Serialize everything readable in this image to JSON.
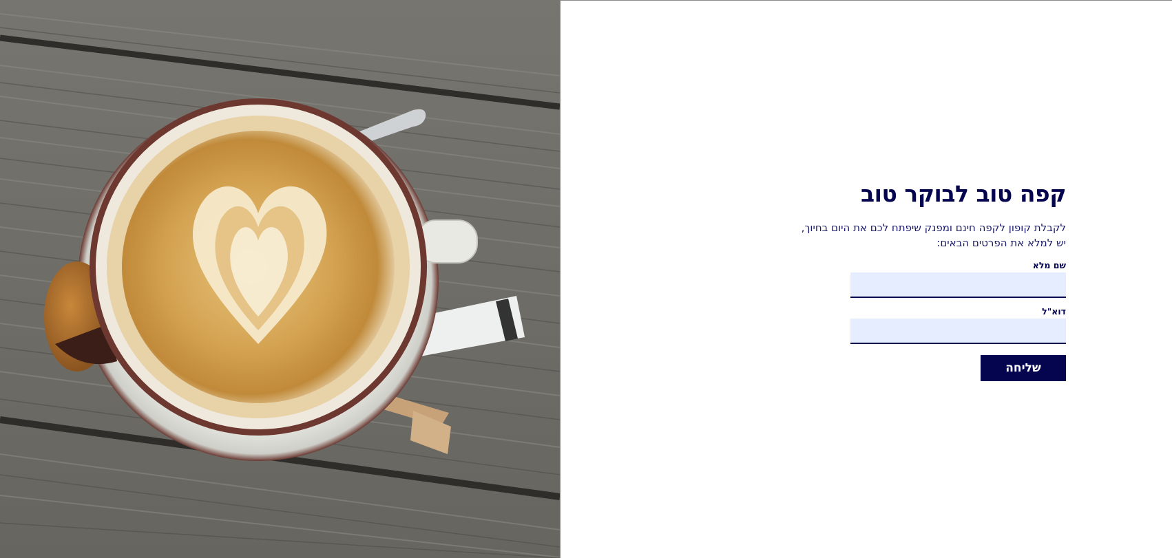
{
  "hero_image": {
    "description_icon": "coffee-cup-photo",
    "colors": {
      "wood": "#6f6d68",
      "saucer": "#dcdcd8",
      "cup_rim": "#6e3a33",
      "crema": "#c9943f",
      "foam": "#f6ecd2"
    }
  },
  "form": {
    "title": "קפה טוב לבוקר טוב",
    "intro_line1": "לקבלת קופון לקפה חינם ומפנק שיפתח לכם את היום בחיוך,",
    "intro_line2": "יש למלא את הפרטים הבאים:",
    "name_label": "שם מלא",
    "name_value": "",
    "email_label": "דוא\"ל",
    "email_value": "",
    "submit_label": "שליחה"
  },
  "colors": {
    "accent": "#05054f",
    "input_background": "#e6edff"
  }
}
